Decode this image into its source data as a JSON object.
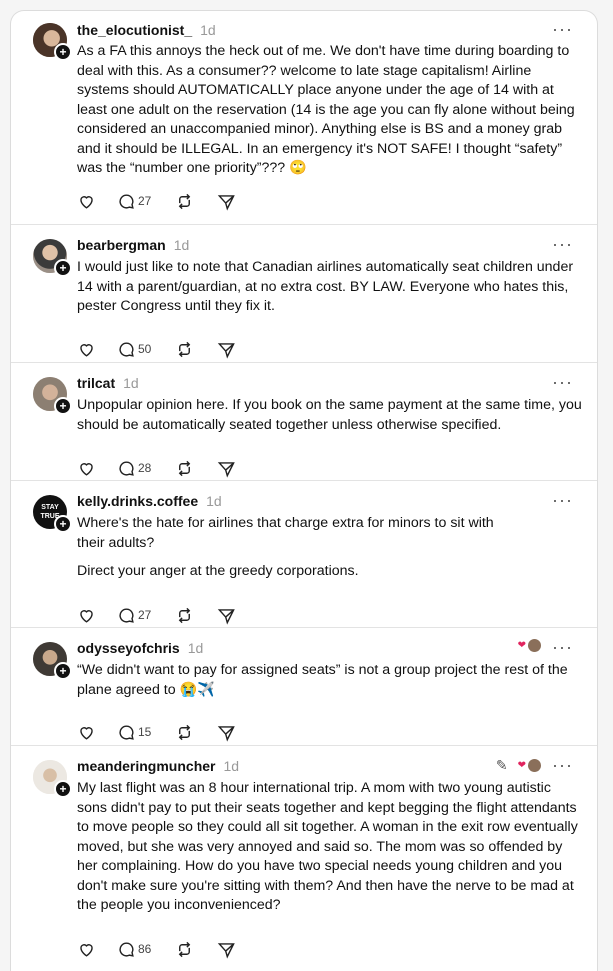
{
  "posts": [
    {
      "username": "the_elocutionist_",
      "time": "1d",
      "paragraphs": [
        "As a FA this annoys the heck out of me. We don't have time during boarding to deal with this. As a consumer?? welcome to late stage capitalism! Airline systems should AUTOMATICALLY place anyone under the age of 14 with at least one adult on the reservation (14 is the age you can fly alone without being considered an unaccompanied minor). Anything else is BS and a money grab and it should be ILLEGAL. In an emergency it's NOT SAFE! I thought “safety” was the “number one priority”??? 🙄"
      ],
      "reply_count": "27"
    },
    {
      "username": "bearbergman",
      "time": "1d",
      "paragraphs": [
        "I would just like to note that Canadian airlines automatically seat children under 14 with a parent/guardian, at no extra cost. BY LAW. Everyone who hates this, pester Congress until they fix it."
      ],
      "reply_count": "50"
    },
    {
      "username": "trilcat",
      "time": "1d",
      "paragraphs": [
        "Unpopular opinion here. If you book on the same payment at the same time, you should be automatically seated together unless otherwise specified."
      ],
      "reply_count": "28"
    },
    {
      "username": "kelly.drinks.coffee",
      "time": "1d",
      "paragraphs": [
        "Where's the hate for airlines that charge extra for minors to sit with their adults?",
        "Direct your anger at the greedy corporations."
      ],
      "reply_count": "27"
    },
    {
      "username": "odysseyofchris",
      "time": "1d",
      "paragraphs": [
        "“We didn't want to pay for assigned seats” is not a group project the rest of the plane agreed to 😭✈️"
      ],
      "reply_count": "15"
    },
    {
      "username": "meanderingmuncher",
      "time": "1d",
      "paragraphs": [
        "My last flight was an 8 hour international trip. A mom with two young autistic sons didn't pay to put their seats together and kept begging the flight attendants to move people so they could all sit together. A woman in the exit row eventually moved, but she was very annoyed and said so. The mom was so offended by her complaining. How do you have two special needs young children and you don't make sure you're sitting with them? And then have the nerve to be mad at the people you inconvenienced?"
      ],
      "reply_count": "86"
    }
  ],
  "more_glyph": "···",
  "avatar4_text": "STAY TRUE",
  "icons": [
    "heart-icon",
    "reply-icon",
    "repost-icon",
    "share-icon",
    "more-icon",
    "follow-plus-icon",
    "edit-icon"
  ]
}
